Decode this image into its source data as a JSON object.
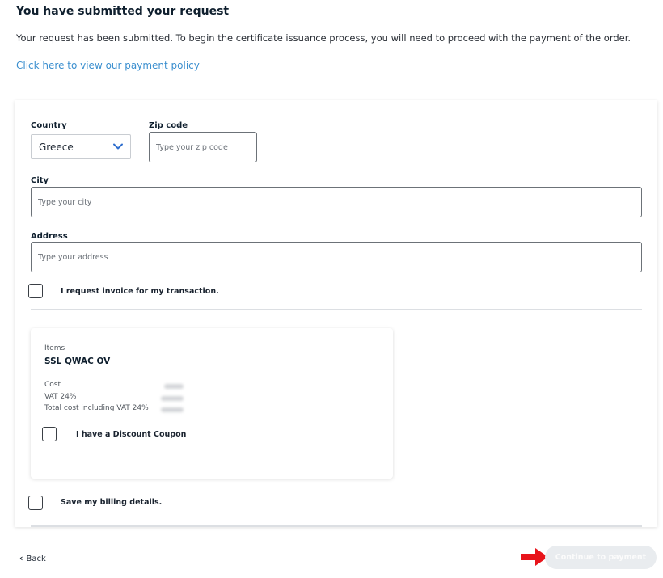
{
  "header": {
    "title": "You have submitted your request",
    "message": "Your request has been submitted. To begin the certificate issuance process, you will need to proceed with the payment of the order.",
    "policy_link": "Click here to view our payment policy"
  },
  "form": {
    "country": {
      "label": "Country",
      "value": "Greece"
    },
    "zip": {
      "label": "Zip code",
      "placeholder": "Type your zip code"
    },
    "city": {
      "label": "City",
      "placeholder": "Type your city"
    },
    "address": {
      "label": "Address",
      "placeholder": "Type your address"
    },
    "invoice_label": "I request invoice for my transaction.",
    "save_billing_label": "Save my billing details."
  },
  "summary": {
    "items_label": "Items",
    "item_name": "SSL QWAC OV",
    "cost_label": "Cost",
    "vat_label": "VAT 24%",
    "total_label": "Total cost including VAT 24%",
    "coupon_label": "I have a Discount Coupon"
  },
  "footer": {
    "back_label": "Back",
    "continue_label": "Continue to payment"
  },
  "colors": {
    "link": "#3b8fcf",
    "arrow": "#e8141b",
    "chevron": "#2f6fce",
    "disabled_button": "#e9ecef"
  },
  "icons": {
    "select_chevron": "chevron-down-icon",
    "back": "chevron-left-icon",
    "annotation": "arrow-right-icon"
  }
}
